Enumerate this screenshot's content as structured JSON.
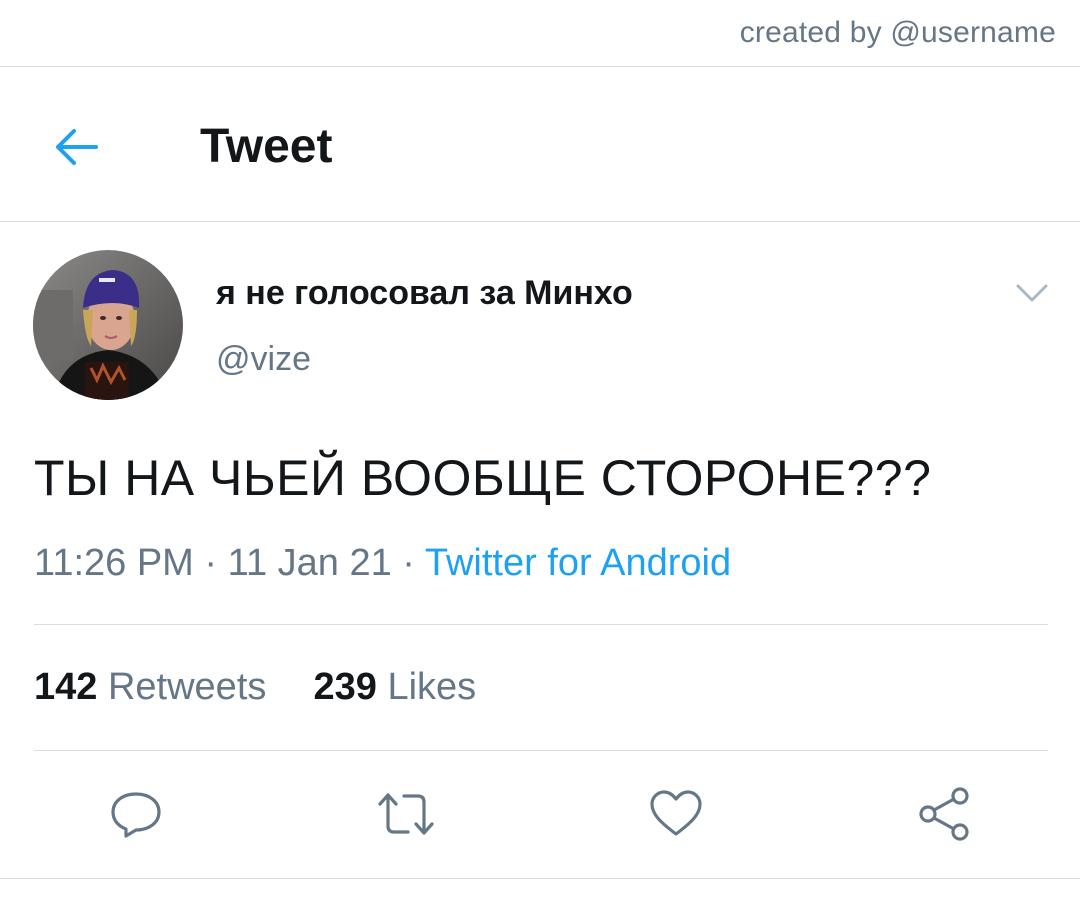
{
  "credit": "created by @username",
  "header": {
    "title": "Tweet",
    "back_icon": "arrow-left-icon",
    "accent_color": "#1da1f2"
  },
  "tweet": {
    "display_name": "я не голосовал за Минхо",
    "handle": "@vize",
    "text": "ТЫ НА ЧЬЕЙ ВООБЩЕ СТОРОНЕ???",
    "time": "11:26 PM",
    "separator": "·",
    "date": "11 Jan 21",
    "source": "Twitter for Android",
    "menu_icon": "chevron-down-icon"
  },
  "stats": {
    "retweets_count": "142",
    "retweets_label": "Retweets",
    "likes_count": "239",
    "likes_label": "Likes"
  },
  "actions": [
    {
      "icon": "reply-icon"
    },
    {
      "icon": "retweet-icon"
    },
    {
      "icon": "heart-icon"
    },
    {
      "icon": "share-icon"
    }
  ],
  "colors": {
    "text_primary": "#14171a",
    "text_secondary": "#657786",
    "divider": "#d9dde1",
    "link": "#1da1f2"
  }
}
